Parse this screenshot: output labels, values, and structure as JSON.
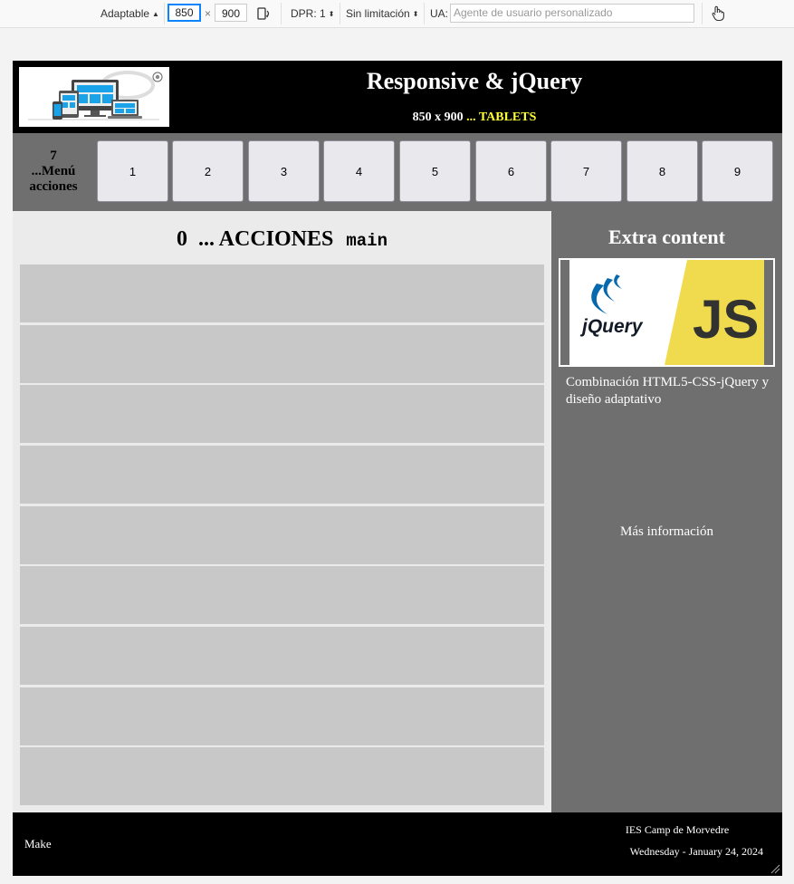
{
  "toolbar": {
    "mode": "Adaptable",
    "width": "850",
    "times": "×",
    "height": "900",
    "dpr": "DPR: 1",
    "throttle": "Sin limitación",
    "ua_label": "UA:",
    "ua_placeholder": "Agente de usuario personalizado"
  },
  "header": {
    "title": "Responsive & jQuery",
    "size": "850 x 900",
    "device": "... TABLETS"
  },
  "nav": {
    "label_count": "7",
    "label_line1": "...Menú",
    "label_line2": "acciones",
    "buttons": [
      "1",
      "2",
      "3",
      "4",
      "5",
      "6",
      "7",
      "8",
      "9"
    ]
  },
  "main": {
    "count": "0",
    "heading": "... ACCIONES",
    "code": "main"
  },
  "aside": {
    "title": "Extra content",
    "image_brand": "jQuery",
    "image_js": "JS",
    "description": "Combinación HTML5-CSS-jQuery y diseño adaptativo",
    "more": "Más información"
  },
  "footer": {
    "left": "Make",
    "school": "IES Camp de Morvedre",
    "date": "Wednesday - January 24, 2024"
  },
  "colors": {
    "header_bg": "#000000",
    "nav_bg": "#6f6f6f",
    "main_bg": "#ebebeb",
    "row_bg": "#c8c8c8",
    "accent_yellow": "#ffff33",
    "js_yellow": "#f0db4f",
    "jquery_blue": "#0769ad"
  }
}
